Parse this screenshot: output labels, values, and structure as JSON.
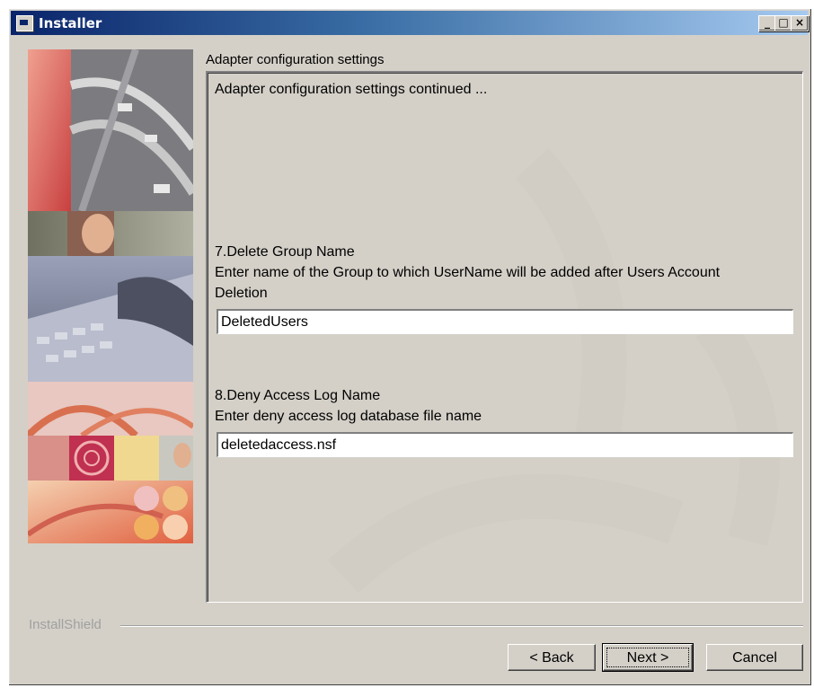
{
  "window": {
    "title": "Installer",
    "minimize_label": "_",
    "maximize_label": "□",
    "close_label": "×"
  },
  "panel": {
    "title": "Adapter configuration settings",
    "intro": "Adapter configuration settings continued ...",
    "item7": {
      "heading": "7.Delete Group Name",
      "description_line1": "Enter name of the Group to which UserName will be added after Users Account",
      "description_line2": "Deletion",
      "value": "DeletedUsers"
    },
    "item8": {
      "heading": "8.Deny Access Log Name",
      "description": "Enter deny access log database file name",
      "value": "deletedaccess.nsf"
    }
  },
  "footer": {
    "brand": "InstallShield",
    "back_label": "< Back",
    "next_label": "Next >",
    "cancel_label": "Cancel"
  },
  "colors": {
    "titlebar_start": "#0a246a",
    "titlebar_end": "#a6caf0",
    "dialog_face": "#d4d0c8"
  }
}
